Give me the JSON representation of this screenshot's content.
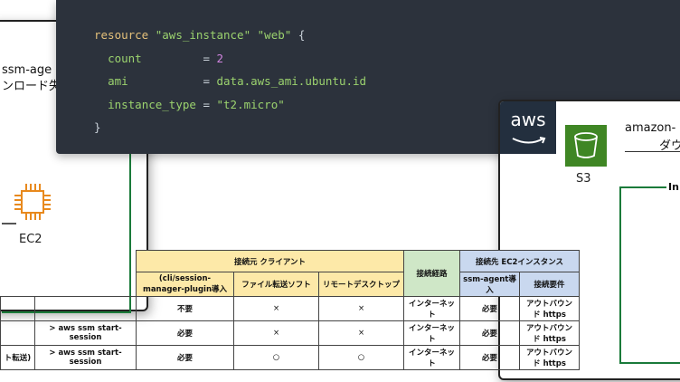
{
  "left_card": {
    "label_line1": "ssm-age",
    "label_line2": "ンロード失敗",
    "ec2_label": "EC2",
    "ec2_icon": "ec2-chip-icon",
    "accent": "#e8891d"
  },
  "code": {
    "resource_kw": "resource",
    "resource_type": "\"aws_instance\"",
    "resource_name": "\"web\"",
    "open_brace": "{",
    "count_key": "count",
    "count_eq": "=",
    "count_val": "2",
    "ami_key": "ami",
    "ami_eq": "=",
    "ami_val": "data.aws_ami.ubuntu.id",
    "type_key": "instance_type",
    "type_eq": "=",
    "type_val": "\"t2.micro\"",
    "close_brace": "}"
  },
  "right_card": {
    "aws_logo": "aws",
    "s3_label": "S3",
    "amazon_label": "amazon-",
    "dl_label": "ダウ",
    "group_label": "In",
    "s3_color": "#3f8624"
  },
  "table": {
    "header_client": "接続元 クライアント",
    "header_path": "接続経路",
    "header_ec2": "接続先 EC2インスタンス",
    "sub_plugin": "(cli/session-manager-plugin導入",
    "sub_file": "ファイル転送ソフト",
    "sub_rdp": "リモートデスクトップ",
    "sub_agent": "ssm-agent導入",
    "sub_req": "接続要件",
    "rows": [
      {
        "cmd": "",
        "method": "",
        "plugin": "不要",
        "file": "×",
        "rdp": "×",
        "path": "インターネット",
        "agent": "必要",
        "req": "アウトバウンド https"
      },
      {
        "cmd": "",
        "method": "> aws ssm start-session",
        "plugin": "必要",
        "file": "×",
        "rdp": "×",
        "path": "インターネット",
        "agent": "必要",
        "req": "アウトバウンド https"
      },
      {
        "cmd": "ト転送)",
        "method": "> aws ssm start-session",
        "plugin": "必要",
        "file": "○",
        "rdp": "○",
        "path": "インターネット",
        "agent": "必要",
        "req": "アウトバウンド https"
      }
    ]
  }
}
